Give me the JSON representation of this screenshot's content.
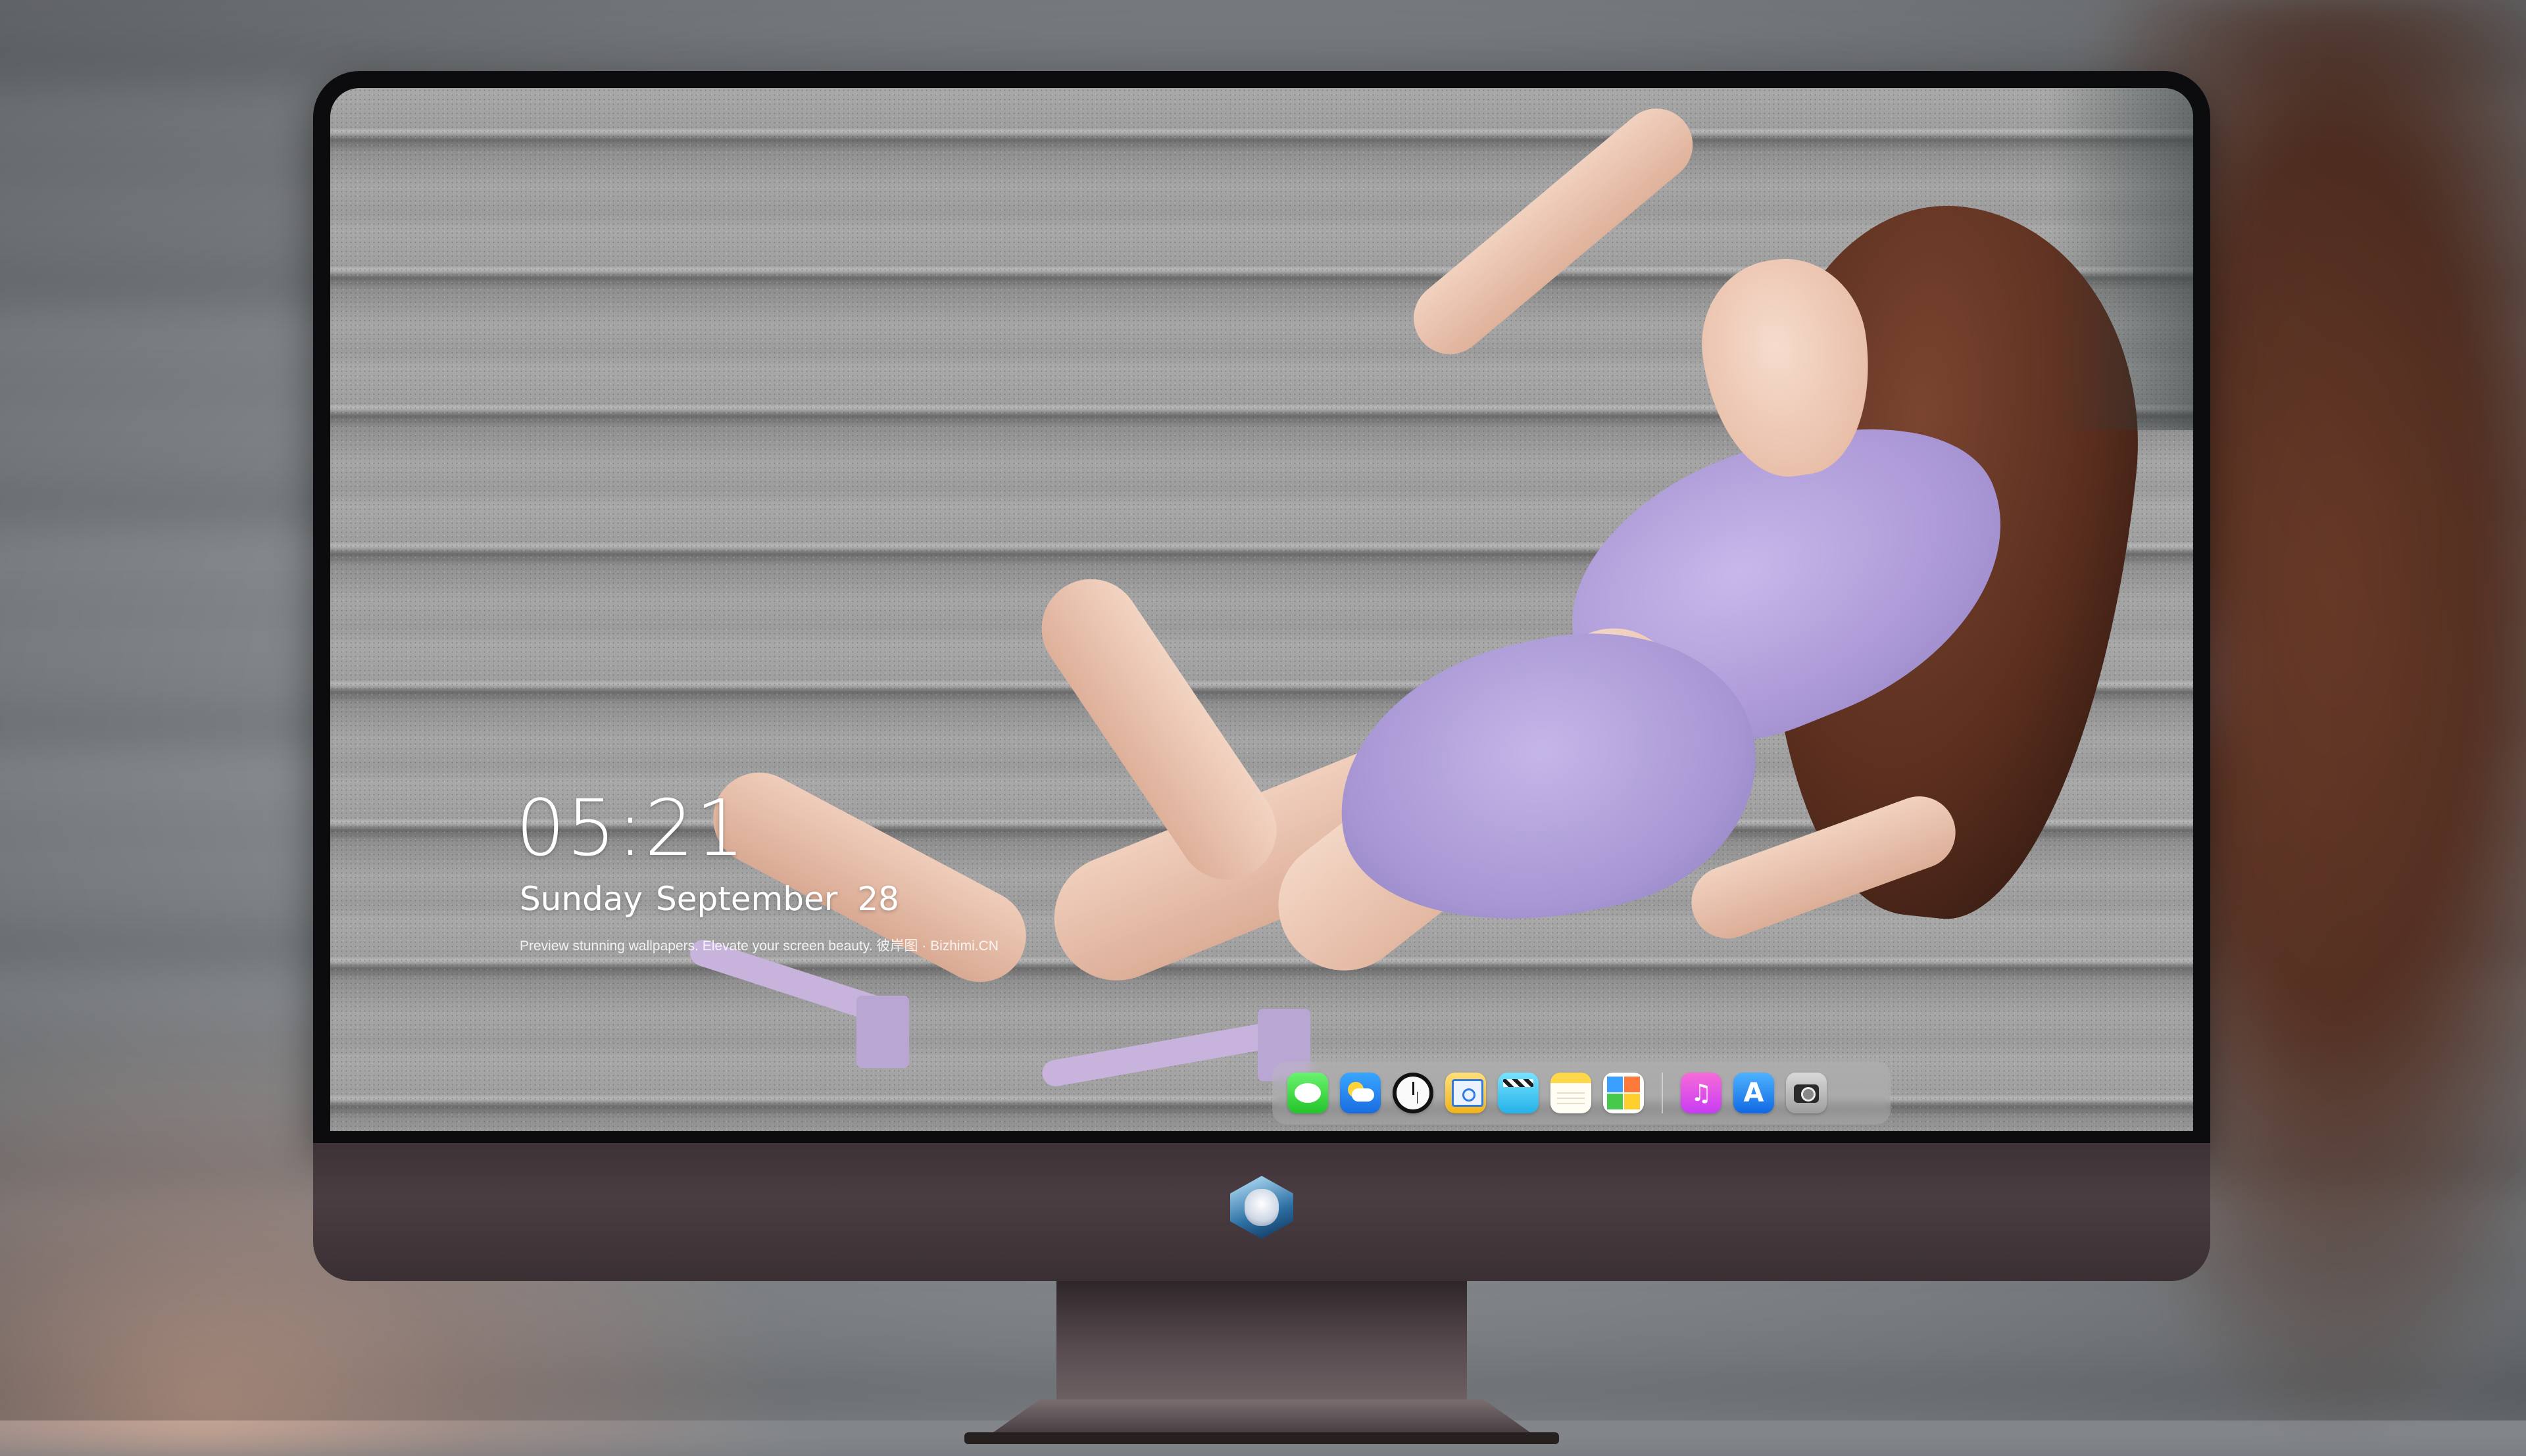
{
  "lockscreen": {
    "time": "05:21",
    "weekday_month": "Sunday September",
    "day": "28",
    "caption": "Preview stunning wallpapers. Elevate your screen beauty. 彼岸图 · Bizhimi.CN"
  },
  "dock": {
    "items": [
      {
        "name": "messages",
        "icon": "messages-icon"
      },
      {
        "name": "weather",
        "icon": "weather-icon"
      },
      {
        "name": "clock",
        "icon": "clock-icon"
      },
      {
        "name": "preview",
        "icon": "preview-icon"
      },
      {
        "name": "video-editor",
        "icon": "clapperboard-icon"
      },
      {
        "name": "notes",
        "icon": "notes-icon"
      },
      {
        "name": "calendar",
        "icon": "calendar-grid-icon"
      },
      {
        "name": "music",
        "icon": "music-note-icon",
        "glyph": "♫"
      },
      {
        "name": "app-store",
        "icon": "app-store-icon",
        "glyph": "A"
      },
      {
        "name": "camera",
        "icon": "camera-icon"
      }
    ]
  },
  "monitor": {
    "chin_logo": "mascot-logo-icon"
  },
  "colors": {
    "dress": "#ab98d6",
    "hair": "#5a2e1e",
    "chin": "#4a3d42"
  }
}
